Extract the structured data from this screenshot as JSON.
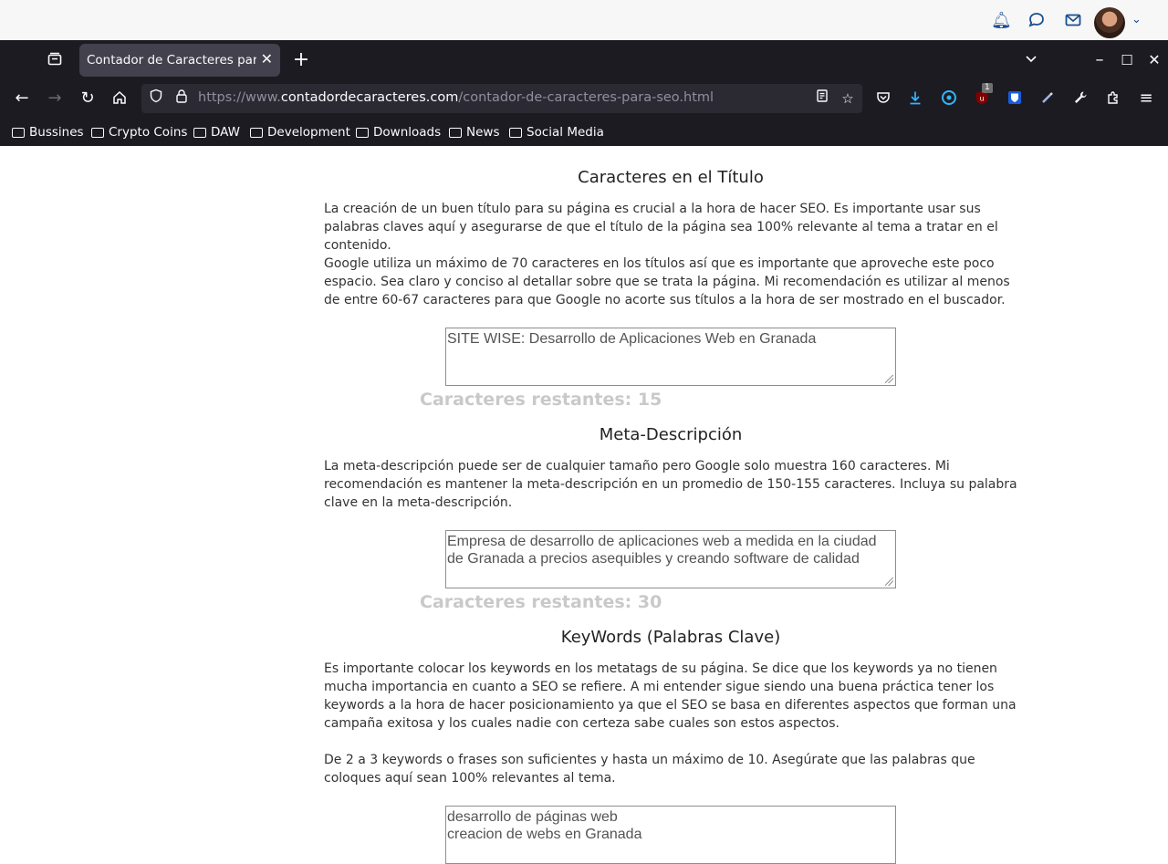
{
  "browser": {
    "tab_title": "Contador de Caracteres para SEO",
    "url_prefix": "https://www.",
    "url_domain": "contadordecaracteres.com",
    "url_path": "/contador-de-caracteres-para-seo.html",
    "extension_badge": "1",
    "bookmarks": [
      "Bussines",
      "Crypto Coins",
      "DAW",
      "Development",
      "Downloads",
      "News",
      "Social Media"
    ]
  },
  "page": {
    "section1": {
      "heading": "Caracteres en el Título",
      "p1": "La creación de un buen título para su página es crucial a la hora de hacer SEO. Es importante usar sus palabras claves aquí y asegurarse de que el título de la página sea 100% relevante al tema a tratar en el contenido.",
      "p2": "Google utiliza un máximo de 70 caracteres en los títulos así que es importante que aproveche este poco espacio. Sea claro y conciso al detallar sobre que se trata la página. Mi recomendación es utilizar al menos de entre 60-67 caracteres para que Google no acorte sus títulos a la hora de ser mostrado en el buscador.",
      "textarea_value": "SITE WISE: Desarrollo de Aplicaciones Web en Granada",
      "counter": "Caracteres restantes: 15"
    },
    "section2": {
      "heading": "Meta-Descripción",
      "p1": "La meta-descripción puede ser de cualquier tamaño pero Google solo muestra 160 caracteres. Mi recomendación es mantener la meta-descripción en un promedio de 150-155 caracteres. Incluya su palabra clave en la meta-descripción.",
      "textarea_value": "Empresa de desarrollo de aplicaciones web a medida en la ciudad de Granada a precios asequibles y creando software de calidad",
      "counter": "Caracteres restantes: 30"
    },
    "section3": {
      "heading": "KeyWords (Palabras Clave)",
      "p1": "Es importante colocar los keywords en los metatags de su página. Se dice que los keywords ya no tienen mucha importancia en cuanto a SEO se refiere. A mi entender sigue siendo una buena práctica tener los keywords a la hora de hacer posicionamiento ya que el SEO se basa en diferentes aspectos que forman una campaña exitosa y los cuales nadie con certeza sabe cuales son estos aspectos.",
      "p2": "De 2 a 3 keywords o frases son suficientes y hasta un máximo de 10. Asegúrate que las palabras que coloques aquí sean 100% relevantes al tema.",
      "textarea_value": "desarrollo de páginas web\ncreacion de webs en Granada"
    }
  }
}
